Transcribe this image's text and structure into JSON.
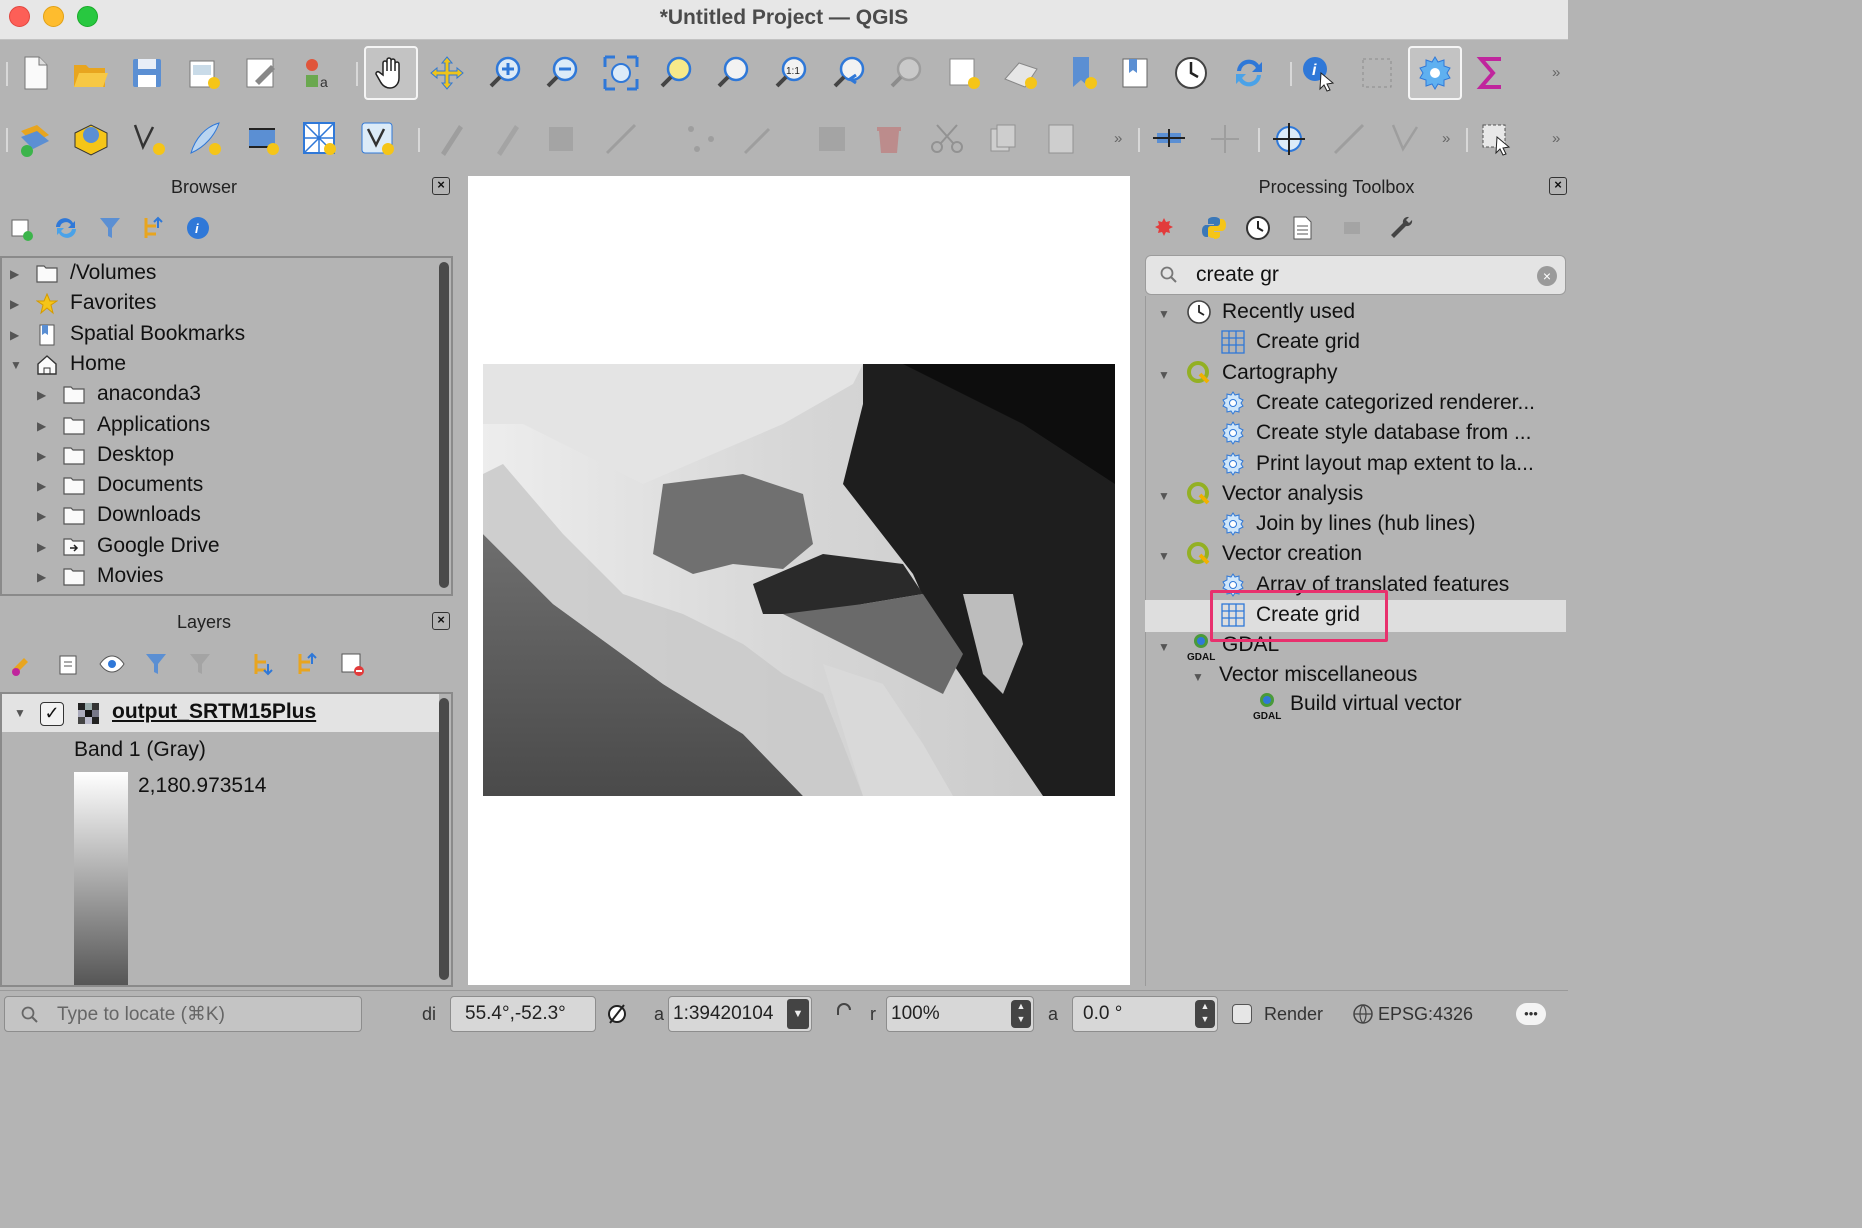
{
  "window": {
    "title": "*Untitled Project — QGIS"
  },
  "browser": {
    "title": "Browser",
    "items": [
      {
        "label": "/Volumes",
        "icon": "folder-icon"
      },
      {
        "label": "Favorites",
        "icon": "star-icon"
      },
      {
        "label": "Spatial Bookmarks",
        "icon": "bookmark-icon"
      },
      {
        "label": "Home",
        "icon": "home-icon"
      },
      {
        "label": "anaconda3",
        "icon": "folder-icon"
      },
      {
        "label": "Applications",
        "icon": "folder-icon"
      },
      {
        "label": "Desktop",
        "icon": "folder-icon"
      },
      {
        "label": "Documents",
        "icon": "folder-icon"
      },
      {
        "label": "Downloads",
        "icon": "folder-icon"
      },
      {
        "label": "Google Drive",
        "icon": "shortcut-folder-icon"
      },
      {
        "label": "Movies",
        "icon": "folder-icon"
      }
    ]
  },
  "layers": {
    "title": "Layers",
    "layer_name": "output_SRTM15Plus",
    "band": "Band 1 (Gray)",
    "max_value": "2,180.973514"
  },
  "processing": {
    "title": "Processing Toolbox",
    "search_value": "create gr",
    "groups": [
      {
        "label": "Recently used",
        "items": [
          "Create grid"
        ]
      },
      {
        "label": "Cartography",
        "items": [
          "Create categorized renderer...",
          "Create style database from ...",
          "Print layout map extent to la..."
        ]
      },
      {
        "label": "Vector analysis",
        "items": [
          "Join by lines (hub lines)"
        ]
      },
      {
        "label": "Vector creation",
        "items": [
          "Array of translated features",
          "Create grid"
        ]
      },
      {
        "label": "GDAL",
        "subgroup": "Vector miscellaneous",
        "items": [
          "Build virtual vector"
        ]
      }
    ]
  },
  "status": {
    "locate_placeholder": "Type to locate (⌘K)",
    "coordinate_label": "di",
    "coordinate": "55.4°,-52.3°",
    "scale_label": "a",
    "scale": "1:39420104",
    "magnifier_label": "r",
    "magnifier": "100%",
    "rotation_label": "a",
    "rotation": "0.0 °",
    "render_label": "Render",
    "crs": "EPSG:4326",
    "more": "•••"
  },
  "colors": {
    "highlight": "#e8306d",
    "accent_blue": "#2f78d8",
    "panel_bg": "#b4b4b4"
  }
}
